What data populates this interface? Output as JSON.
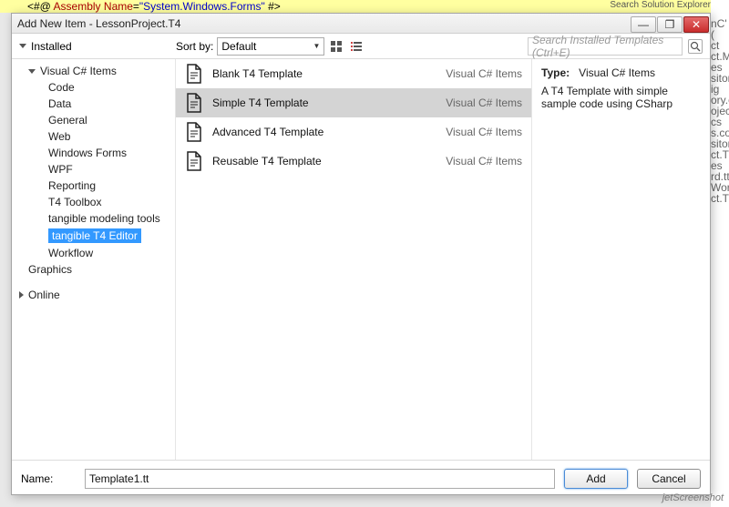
{
  "bg": {
    "code_prefix": "<#@ ",
    "code_kw": "Assembly",
    "code_attr": " Name",
    "code_eq": "=",
    "code_str": "\"System.Windows.Forms\"",
    "code_suffix": " #>",
    "sol_title": "Search Solution Explorer",
    "sol_lines": [
      "nC' (",
      "ct",
      "ct.M",
      "es",
      "sitor",
      "ig",
      "ory.c",
      "ojec",
      "cs",
      "s.co",
      "sitor",
      "ct.T",
      "es",
      "rd.tt",
      "Wor",
      "ct.T"
    ]
  },
  "window": {
    "title": "Add New Item - LessonProject.T4",
    "min": "—",
    "restore": "❐",
    "close": "✕"
  },
  "topbar": {
    "installed_label": "Installed",
    "sort_label": "Sort by:",
    "sort_value": "Default",
    "search_placeholder": "Search Installed Templates (Ctrl+E)"
  },
  "sidebar": {
    "root": "Visual C# Items",
    "items": [
      {
        "label": "Code"
      },
      {
        "label": "Data"
      },
      {
        "label": "General"
      },
      {
        "label": "Web"
      },
      {
        "label": "Windows Forms"
      },
      {
        "label": "WPF"
      },
      {
        "label": "Reporting"
      },
      {
        "label": "T4 Toolbox"
      },
      {
        "label": "tangible modeling tools"
      },
      {
        "label": "tangible T4 Editor",
        "selected": true
      },
      {
        "label": "Workflow"
      }
    ],
    "second": "Graphics",
    "online": "Online"
  },
  "list": {
    "rows": [
      {
        "label": "Blank T4 Template",
        "cat": "Visual C# Items"
      },
      {
        "label": "Simple T4 Template",
        "cat": "Visual C# Items",
        "selected": true
      },
      {
        "label": "Advanced T4 Template",
        "cat": "Visual C# Items"
      },
      {
        "label": "Reusable T4 Template",
        "cat": "Visual C# Items"
      }
    ]
  },
  "details": {
    "type_label": "Type:",
    "type_value": "Visual C# Items",
    "desc": "A T4 Template with simple sample code using CSharp"
  },
  "footer": {
    "name_label": "Name:",
    "name_value": "Template1.tt",
    "add": "Add",
    "cancel": "Cancel"
  },
  "watermark": "jetScreenshot"
}
